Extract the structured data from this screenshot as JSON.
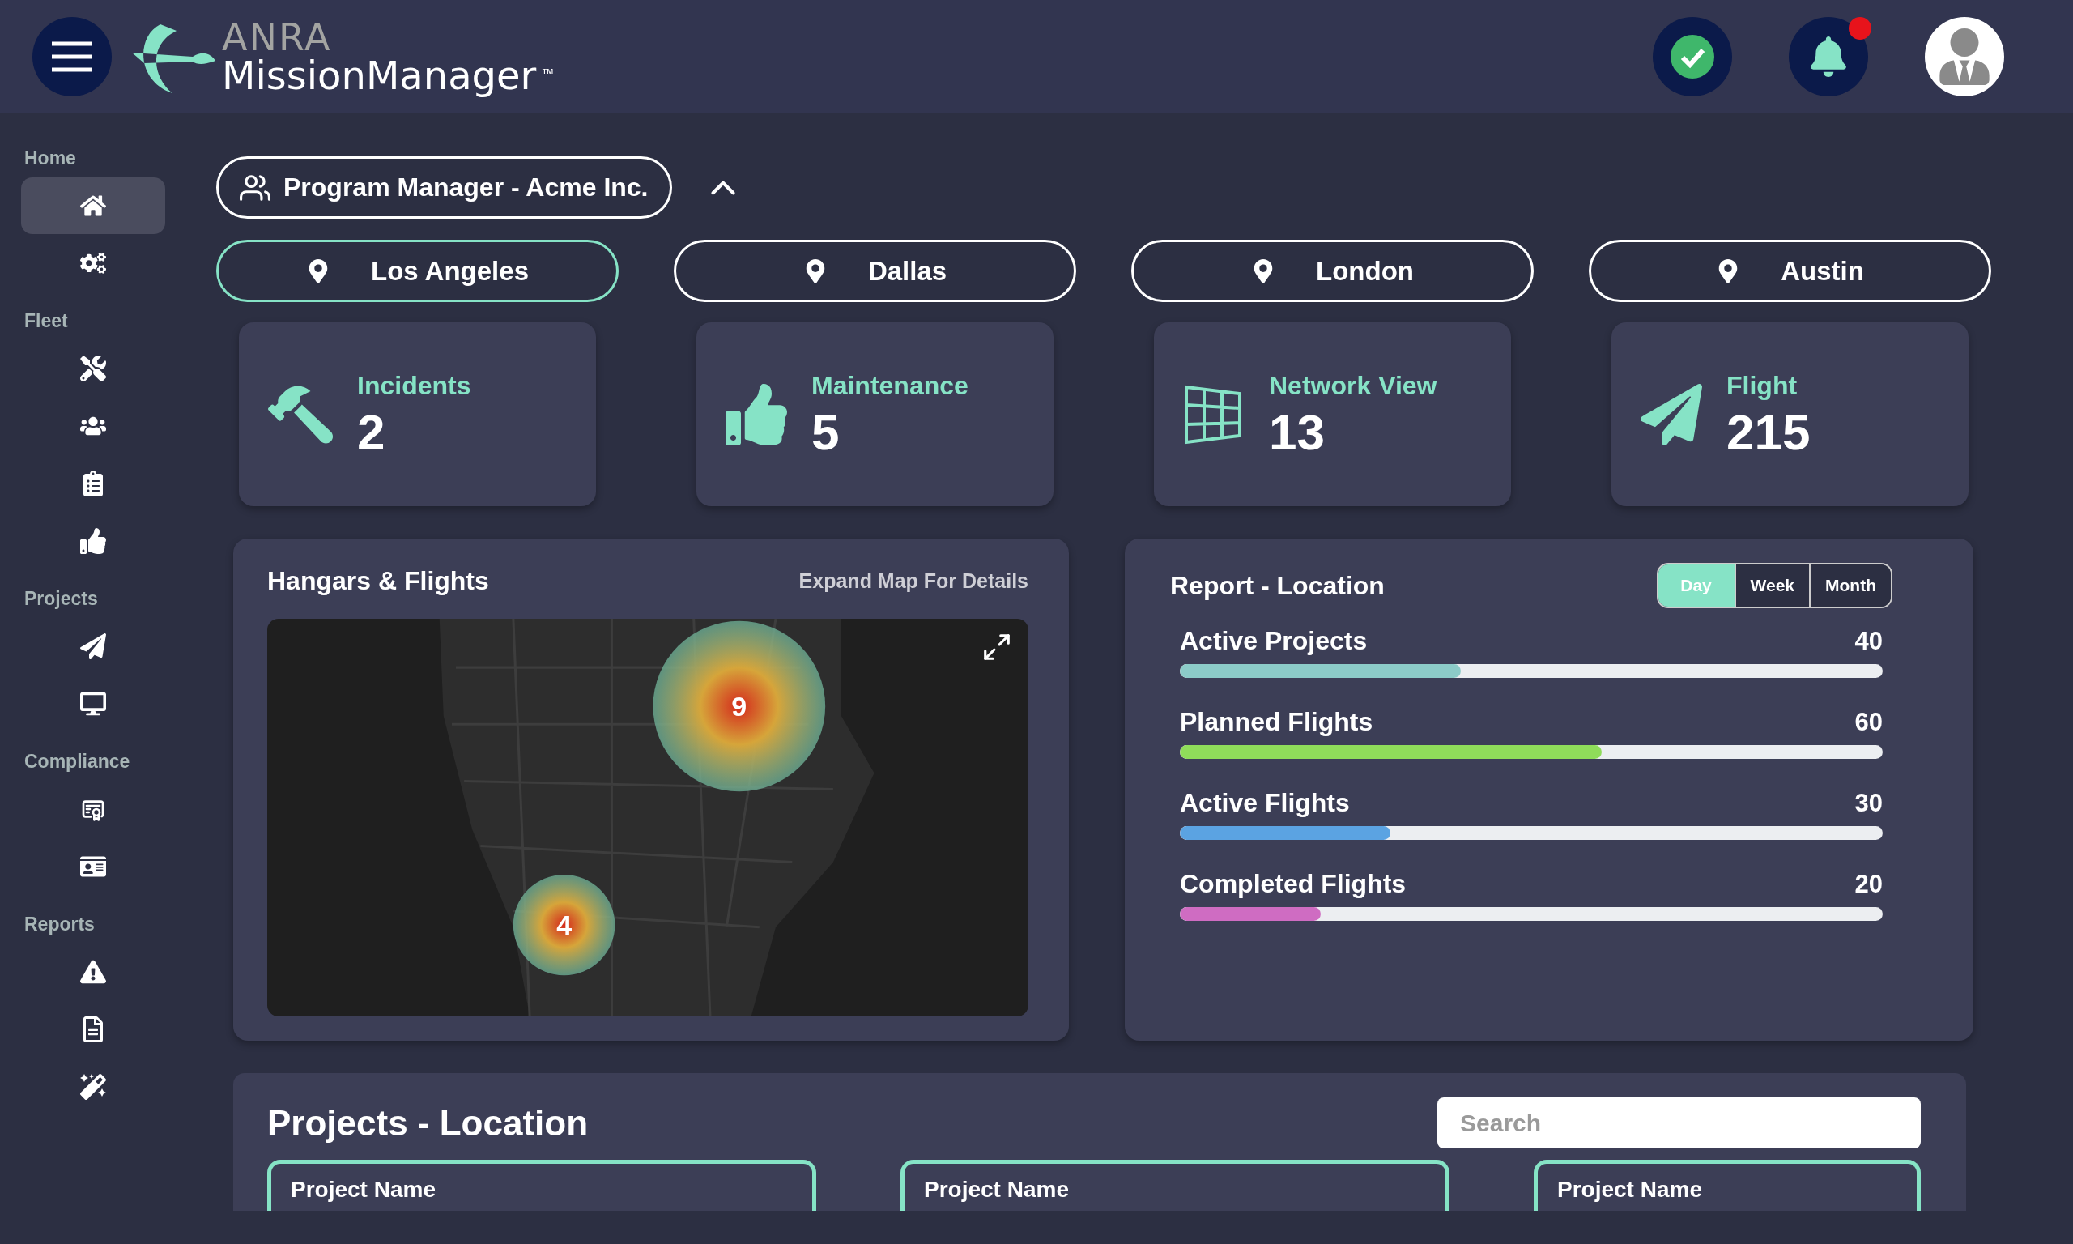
{
  "header": {
    "logo_top": "ANRA",
    "logo_main": "MissionManager",
    "logo_mark": "™",
    "status_ok": true,
    "has_notification": true
  },
  "sidebar": {
    "sections": [
      {
        "label": "Home",
        "items": [
          {
            "selected": true
          },
          {
            "selected": false
          }
        ]
      },
      {
        "label": "Fleet",
        "items": [
          {
            "selected": false
          },
          {
            "selected": false
          },
          {
            "selected": false
          },
          {
            "selected": false
          }
        ]
      },
      {
        "label": "Projects",
        "items": [
          {
            "selected": false
          },
          {
            "selected": false
          }
        ]
      },
      {
        "label": "Compliance",
        "items": [
          {
            "selected": false
          },
          {
            "selected": false
          }
        ]
      },
      {
        "label": "Reports",
        "items": [
          {
            "selected": false
          },
          {
            "selected": false
          },
          {
            "selected": false
          }
        ]
      }
    ]
  },
  "role": {
    "label": "Program Manager - Acme Inc.",
    "expanded": true
  },
  "locations": [
    {
      "label": "Los Angeles",
      "selected": true
    },
    {
      "label": "Dallas",
      "selected": false
    },
    {
      "label": "London",
      "selected": false
    },
    {
      "label": "Austin",
      "selected": false
    }
  ],
  "stats": [
    {
      "label": "Incidents",
      "value": "2"
    },
    {
      "label": "Maintenance",
      "value": "5"
    },
    {
      "label": "Network View",
      "value": "13"
    },
    {
      "label": "Flight",
      "value": "215"
    }
  ],
  "map_panel": {
    "title": "Hangars & Flights",
    "link": "Expand Map For Details",
    "clusters": [
      {
        "count": "9"
      },
      {
        "count": "4"
      }
    ]
  },
  "report": {
    "title": "Report - Location",
    "periods": [
      {
        "label": "Day",
        "selected": true
      },
      {
        "label": "Week",
        "selected": false
      },
      {
        "label": "Month",
        "selected": false
      }
    ],
    "metrics": [
      {
        "name": "Active Projects",
        "reading": "40",
        "level": 0.4,
        "color": "#8ccbc8"
      },
      {
        "name": "Planned Flights",
        "reading": "60",
        "level": 0.6,
        "color": "#8fdc5a"
      },
      {
        "name": "Active Flights",
        "reading": "30",
        "level": 0.3,
        "color": "#5ba3e2"
      },
      {
        "name": "Completed Flights",
        "reading": "20",
        "level": 0.2,
        "color": "#cf6cc2"
      }
    ]
  },
  "projects": {
    "title": "Projects - Location",
    "search": {
      "placeholder": "Search"
    },
    "cards": [
      {
        "title": "Project Name"
      },
      {
        "title": "Project Name"
      },
      {
        "title": "Project Name"
      }
    ]
  }
}
